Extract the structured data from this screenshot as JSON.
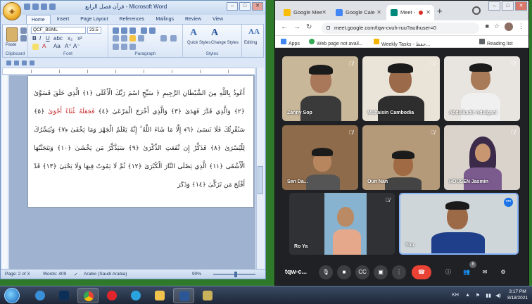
{
  "word": {
    "title": "قرآن فصل الرابع - Microsoft Word",
    "tabs": [
      "Home",
      "Insert",
      "Page Layout",
      "References",
      "Mailings",
      "Review",
      "View"
    ],
    "active_tab": "Home",
    "clipboard": {
      "paste_label": "Paste",
      "group_label": "Clipboard"
    },
    "font": {
      "name": "QCF_BSML",
      "size": "23.5",
      "group_label": "Font"
    },
    "paragraph": {
      "group_label": "Paragraph"
    },
    "styles": {
      "quick_label": "Quick Styles",
      "change_label": "Change Styles",
      "group_label": "Styles"
    },
    "editing": {
      "label": "Editing"
    },
    "verses": [
      {
        "text": "أَعُوذُ بِاللَّهِ مِنَ الشَّيْطَانِ الرَّجِيمِ ﴿ سَبِّحِ اسْمَ رَبِّكَ الْأَعْلَى ﴿١﴾ الَّذِي خَلَقَ فَسَوَّىٰ ﴿٢﴾",
        "red": ""
      },
      {
        "text": "وَالَّذِي قَدَّرَ فَهَدَىٰ ﴿٣﴾ وَالَّذِي أَخْرَجَ الْمَرْعَىٰ ﴿٤﴾",
        "red": "فَجَعَلَهُ غُثَاءً أَحْوَىٰ",
        "after": "﴿٥﴾ سَنُقْرِئُكَ"
      },
      {
        "text": "فَلَا تَنسَىٰ ﴿٦﴾ إِلَّا مَا شَاءَ اللَّهُ ۚ إِنَّهُ يَعْلَمُ الْجَهْرَ وَمَا يَخْفَىٰ ﴿٧﴾ وَنُيَسِّرُكَ لِلْيُسْرَىٰ ﴿٨﴾",
        "red": ""
      },
      {
        "text": "فَذَكِّرْ إِن نَّفَعَتِ الذِّكْرَىٰ ﴿٩﴾ سَيَذَّكَّرُ مَن يَخْشَىٰ ﴿١٠﴾ وَيَتَجَنَّبُهَا الْأَشْقَى ﴿١١﴾ الَّذِي",
        "red": ""
      },
      {
        "text": "يَصْلَى النَّارَ الْكُبْرَىٰ ﴿١٢﴾ ثُمَّ لَا يَمُوتُ فِيهَا وَلَا يَحْيَىٰ ﴿١٣﴾ قَدْ أَفْلَحَ مَن تَزَكَّىٰ ﴿١٤﴾ وَذَكَرَ",
        "red": ""
      }
    ],
    "status": {
      "page": "Page: 2 of 3",
      "words": "Words: 409",
      "language": "Arabic (Saudi Arabia)",
      "zoom": "90%"
    }
  },
  "chrome": {
    "tabs": [
      {
        "label": "Google Mee",
        "color": "#fbbc04"
      },
      {
        "label": "Google Cale",
        "color": "#4285f4"
      },
      {
        "label": "Meet - ",
        "color": "#00897b",
        "active": true,
        "recording": true
      }
    ],
    "url": "meet.google.com/tqw-cvuh-ruu?authuser=0",
    "bookmarks": [
      "Apps",
      "Web page not avail...",
      "Weekly Tasks - حفظ..."
    ],
    "reading_list": "Reading list"
  },
  "meet": {
    "participants": [
      {
        "name": "Zanny Sop",
        "muted": true,
        "bg": "#c9b79a",
        "skin": "#a9785a",
        "shirt": "#3a3a3a"
      },
      {
        "name": "Muhaisin Cambodia",
        "muted": true,
        "bg": "#e9e3d8",
        "skin": "#9a6a4a",
        "shirt": "#2e2e2e"
      },
      {
        "name": "Abdulkadir Adulgani",
        "muted": true,
        "bg": "#e8e4df",
        "skin": "#a97a58",
        "shirt": "#f0f0f0"
      },
      {
        "name": "Sen Da...",
        "muted": true,
        "bg": "#8e6b4a",
        "skin": "#b7855e",
        "shirt": "#555"
      },
      {
        "name": "Oun Nan",
        "muted": true,
        "bg": "#b59a7a",
        "skin": "#a06a45",
        "shirt": "#444"
      },
      {
        "name": "HOUSEN Jasmin",
        "muted": true,
        "bg": "#d9d3cc",
        "skin": "#c99672",
        "shirt": "#7b5a8e"
      },
      {
        "name": "Ro Ya",
        "muted": true,
        "bg": "#87b3d1",
        "skin": "#b98a64",
        "shirt": "#e5a88a"
      },
      {
        "name": "You",
        "muted": false,
        "bg": "#cfd6d9",
        "skin": "#9d6a47",
        "shirt": "#1f3f8a"
      }
    ],
    "meeting_code": "tqw-c...",
    "participant_count": "8"
  },
  "taskbar": {
    "apps": [
      "Internet Explorer",
      "Photoshop",
      "Chrome",
      "Opera",
      "Telegram",
      "Folder",
      "Word",
      "Notepad"
    ],
    "time": "3:17 PM",
    "date": "8/18/2021",
    "language": "KH"
  }
}
